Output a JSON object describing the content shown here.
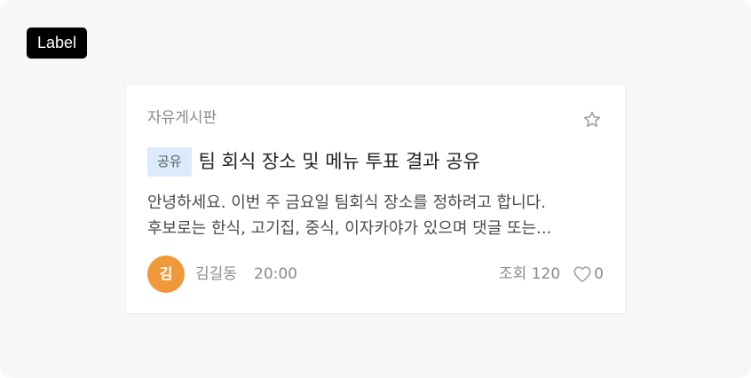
{
  "badge": {
    "label": "Label"
  },
  "card": {
    "board_name": "자유게시판",
    "tag": "공유",
    "title": "팀 회식 장소 및 메뉴 투표 결과 공유",
    "body_lines": [
      "안녕하세요. 이번 주 금요일 팀회식 장소를 정하려고 합니다.",
      "후보로는 한식, 고기집, 중식, 이자카야가 있으며 댓글 또는..."
    ],
    "author": {
      "initial": "김",
      "name": "김길동",
      "avatar_color": "#F0993A"
    },
    "time": "20:00",
    "views": "조회 120",
    "likes": "0",
    "icons": {
      "favorite": "star-outline-icon",
      "like": "heart-outline-icon"
    }
  },
  "colors": {
    "background": "#F7F7F7",
    "tag_background": "#DCEBFB",
    "label_background": "#000000"
  }
}
